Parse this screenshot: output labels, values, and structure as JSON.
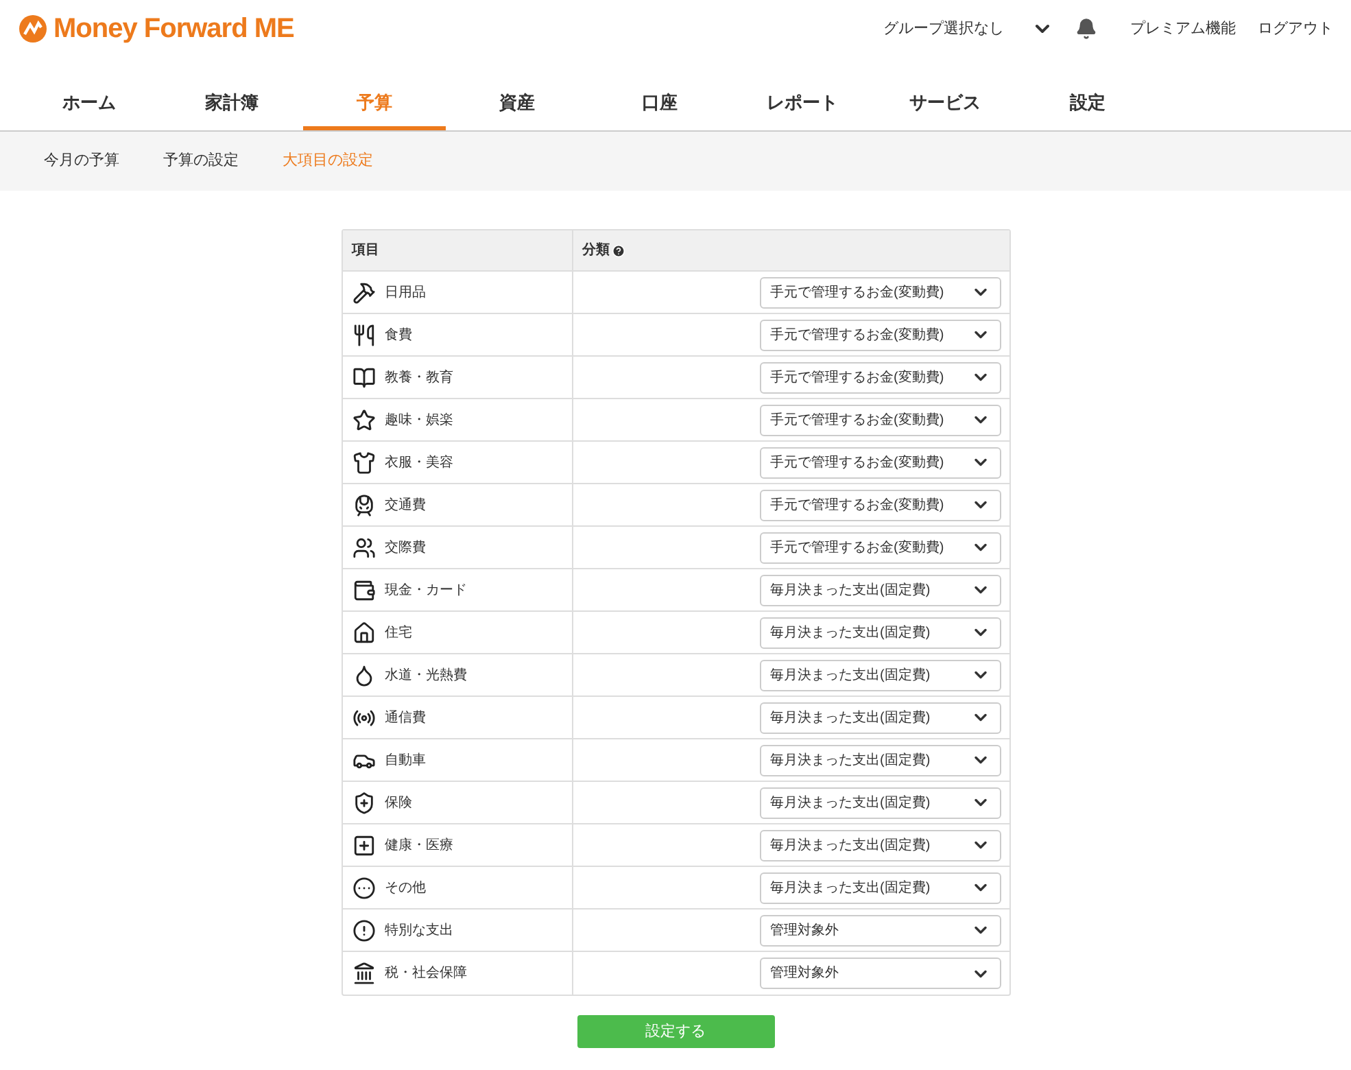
{
  "header": {
    "logo": "Money Forward ME",
    "group_select": "グループ選択なし",
    "links": [
      "プレミアム機能",
      "ログアウト"
    ]
  },
  "tabs": [
    {
      "label": "ホーム",
      "selected": false
    },
    {
      "label": "家計簿",
      "selected": false
    },
    {
      "label": "予算",
      "selected": true
    },
    {
      "label": "資産",
      "selected": false
    },
    {
      "label": "口座",
      "selected": false
    },
    {
      "label": "レポート",
      "selected": false
    },
    {
      "label": "サービス",
      "selected": false
    },
    {
      "label": "設定",
      "selected": false
    }
  ],
  "subtabs": [
    {
      "label": "今月の予算",
      "selected": false
    },
    {
      "label": "予算の設定",
      "selected": false
    },
    {
      "label": "大項目の設定",
      "selected": true
    }
  ],
  "table": {
    "columns": [
      "項目",
      "分類"
    ],
    "rows": [
      {
        "name": "日用品",
        "category": "手元で管理するお金(変動費)"
      },
      {
        "name": "食費",
        "category": "手元で管理するお金(変動費)"
      },
      {
        "name": "教養・教育",
        "category": "手元で管理するお金(変動費)"
      },
      {
        "name": "趣味・娯楽",
        "category": "手元で管理するお金(変動費)"
      },
      {
        "name": "衣服・美容",
        "category": "手元で管理するお金(変動費)"
      },
      {
        "name": "交通費",
        "category": "手元で管理するお金(変動費)"
      },
      {
        "name": "交際費",
        "category": "手元で管理するお金(変動費)"
      },
      {
        "name": "現金・カード",
        "category": "毎月決まった支出(固定費)"
      },
      {
        "name": "住宅",
        "category": "毎月決まった支出(固定費)"
      },
      {
        "name": "水道・光熱費",
        "category": "毎月決まった支出(固定費)"
      },
      {
        "name": "通信費",
        "category": "毎月決まった支出(固定費)"
      },
      {
        "name": "自動車",
        "category": "毎月決まった支出(固定費)"
      },
      {
        "name": "保険",
        "category": "毎月決まった支出(固定費)"
      },
      {
        "name": "健康・医療",
        "category": "毎月決まった支出(固定費)"
      },
      {
        "name": "その他",
        "category": "毎月決まった支出(固定費)"
      },
      {
        "name": "特別な支出",
        "category": "管理対象外"
      },
      {
        "name": "税・社会保障",
        "category": "管理対象外"
      }
    ]
  },
  "submit": "設定する"
}
